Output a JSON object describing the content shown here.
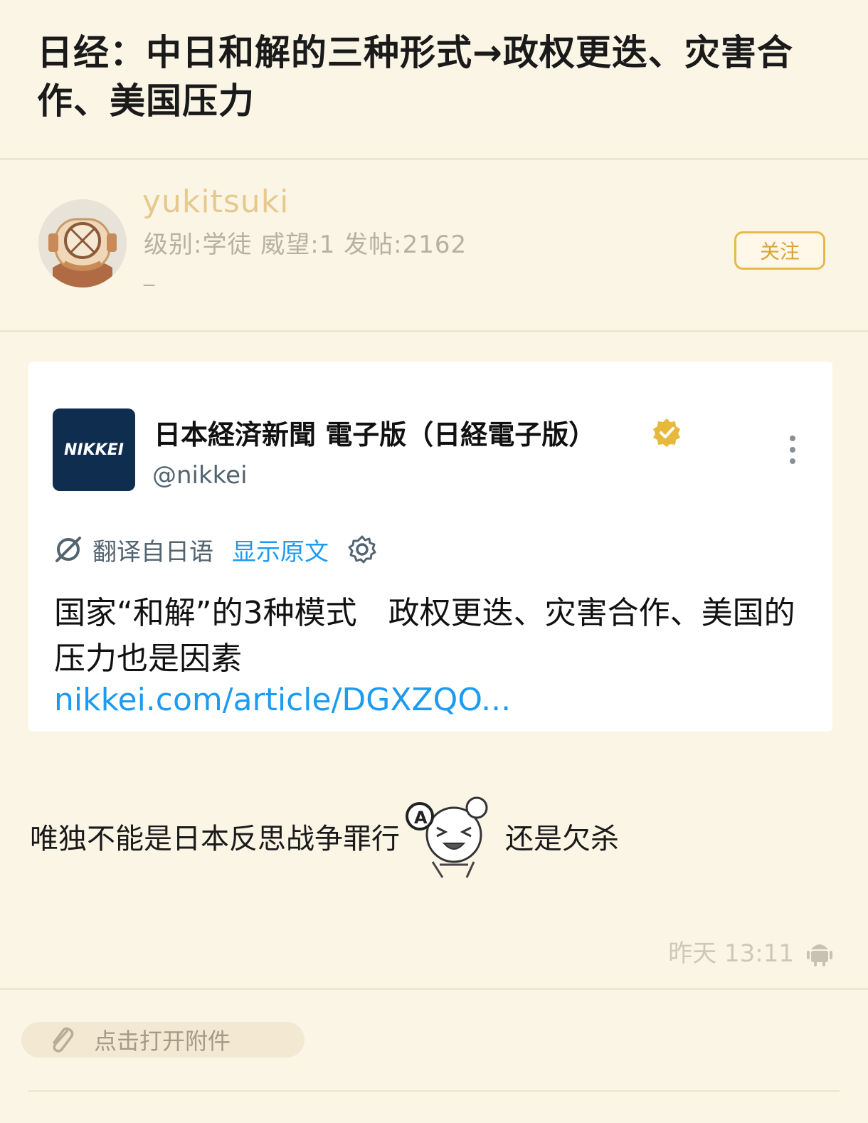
{
  "post": {
    "title": "日经：中日和解的三种形式→政权更迭、灾害合作、美国压力"
  },
  "author": {
    "username": "yukitsuki",
    "info": "级别:学徒  威望:1  发帖:2162",
    "signature": "_",
    "follow_label": "关注"
  },
  "tweet_card": {
    "logo_text": "NIKKEI",
    "account_name": "日本経済新聞 電子版（日経電子版）",
    "handle": "@nikkei",
    "translated_from": "翻译自日语",
    "show_original": "显示原文",
    "text": "国家“和解”的3种模式　政权更迭、灾害合作、美国的压力也是因素",
    "link": "nikkei.com/article/DGXZQO..."
  },
  "reply": {
    "text_before": "唯独不能是日本反思战争罪行",
    "text_after": "还是欠杀"
  },
  "meta": {
    "timestamp": "昨天 13:11"
  },
  "attachment": {
    "label": "点击打开附件"
  },
  "colors": {
    "page_bg": "#fbf5e6",
    "username": "#e6c98c",
    "follow_accent": "#e6b94a",
    "link_blue": "#1d9bf0",
    "nikkei_navy": "#0f2d4e"
  },
  "icons": [
    "avatar-diving-helmet",
    "verified-badge-icon",
    "more-vertical-icon",
    "translate-icon",
    "gear-icon",
    "sticker-laughing-girl",
    "android-icon",
    "paperclip-icon"
  ]
}
